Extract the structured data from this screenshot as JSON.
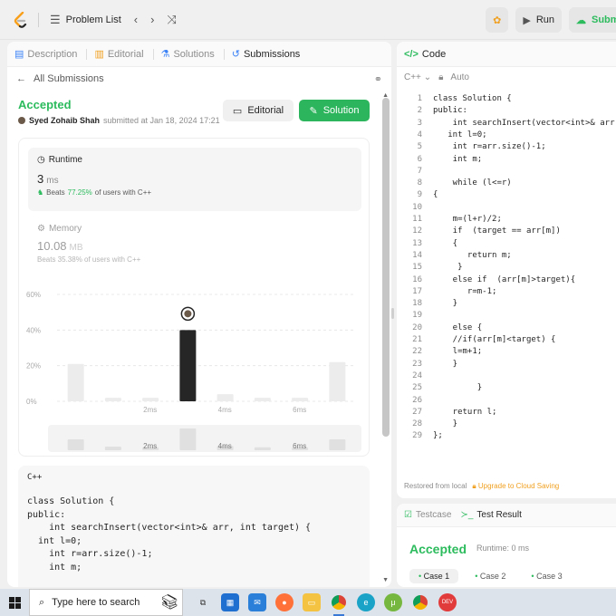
{
  "topbar": {
    "problem_list": "Problem List",
    "run": "Run",
    "submit": "Subm"
  },
  "left": {
    "tabs": [
      "Description",
      "Editorial",
      "Solutions",
      "Submissions"
    ],
    "back": "All Submissions",
    "status": "Accepted",
    "author": "Syed Zohaib Shah",
    "submitted": "submitted at Jan 18, 2024 17:21",
    "editorial_btn": "Editorial",
    "solution_btn": "Solution",
    "runtime": {
      "title": "Runtime",
      "value": "3",
      "unit": "ms",
      "beats_prefix": "Beats",
      "beats_pct": "77.25%",
      "beats_suffix": "of users with C++"
    },
    "memory": {
      "title": "Memory",
      "value": "10.08",
      "unit": "MB",
      "beats": "Beats 35.38% of users with C++"
    },
    "code_card": {
      "lang": "C++",
      "lines": [
        "class Solution {",
        "public:",
        "    int searchInsert(vector<int>& arr, int target) {",
        "  int l=0;",
        "    int r=arr.size()-1;",
        "    int m;"
      ]
    }
  },
  "chart_data": {
    "type": "bar",
    "yticks": [
      "60%",
      "40%",
      "20%",
      "0%"
    ],
    "ylim": [
      0,
      60
    ],
    "xticks": [
      "2ms",
      "4ms",
      "6ms"
    ],
    "values": [
      21,
      2,
      2,
      40,
      4,
      2,
      2,
      22
    ],
    "highlight_index": 3,
    "mini_xticks": [
      "2ms",
      "4ms",
      "6ms"
    ],
    "mini_values": [
      30,
      10,
      8,
      60,
      12,
      8,
      8,
      30
    ]
  },
  "right": {
    "title": "Code",
    "lang": "C++",
    "mode": "Auto",
    "footer_local": "Restored from local",
    "footer_upgrade": "Upgrade to Cloud Saving",
    "lines": [
      "class Solution {",
      "public:",
      "    int searchInsert(vector<int>& arr,",
      "   int l=0;",
      "    int r=arr.size()-1;",
      "    int m;",
      "",
      "    while (l<=r)",
      "{",
      "",
      "    m=(l+r)/2;",
      "    if  (target == arr[m])",
      "    {",
      "       return m;",
      "     }",
      "    else if  (arr[m]>target){",
      "       r=m-1;",
      "    }",
      "",
      "    else {",
      "    //if(arr[m]<target) {",
      "    l=m+1;",
      "    }",
      "",
      "         }",
      "",
      "    return l;",
      "    }",
      "};"
    ]
  },
  "testresult": {
    "tabs": [
      "Testcase",
      "Test Result"
    ],
    "status": "Accepted",
    "runtime": "Runtime: 0 ms",
    "cases": [
      "Case 1",
      "Case 2",
      "Case 3"
    ]
  },
  "taskbar": {
    "search_placeholder": "Type here to search"
  }
}
